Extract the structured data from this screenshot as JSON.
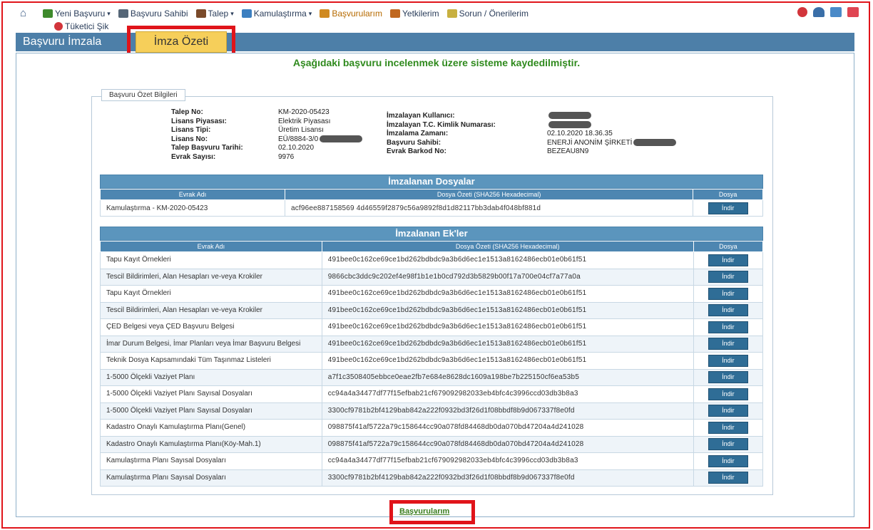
{
  "menu": {
    "row1": [
      {
        "label": "Yeni Başvuru",
        "caret": true,
        "color": "#3e8a2c"
      },
      {
        "label": "Başvuru Sahibi",
        "caret": false,
        "color": "#556677"
      },
      {
        "label": "Talep",
        "caret": true,
        "color": "#7a4a2a"
      },
      {
        "label": "Kamulaştırma",
        "caret": true,
        "color": "#3c7fc0"
      },
      {
        "label": "Başvurularım",
        "caret": false,
        "color": "#d08a20",
        "active": true
      },
      {
        "label": "Yetkilerim",
        "caret": false,
        "color": "#c06820"
      },
      {
        "label": "Sorun / Önerilerim",
        "caret": false,
        "color": "#c8b040"
      }
    ],
    "row2_label": "Tüketici Şik"
  },
  "tabs": {
    "main": "Başvuru İmzala",
    "summary": "İmza Özeti"
  },
  "success_message": "Aşağıdaki başvuru incelenmek üzere sisteme kaydedilmiştir.",
  "summary": {
    "legend": "Başvuru Özet Bilgileri",
    "left": [
      {
        "k": "Talep No:",
        "v": "KM-2020-05423"
      },
      {
        "k": "Lisans Piyasası:",
        "v": "Elektrik Piyasası"
      },
      {
        "k": "Lisans Tipi:",
        "v": "Üretim Lisansı"
      },
      {
        "k": "Lisans No:",
        "v": "EÜ/8884-3/0"
      },
      {
        "k": "Talep Başvuru Tarihi:",
        "v": "02.10.2020"
      },
      {
        "k": "Evrak Sayısı:",
        "v": "9976"
      }
    ],
    "right": [
      {
        "k": "İmzalayan Kullanıcı:",
        "v": ""
      },
      {
        "k": "İmzalayan T.C. Kimlik Numarası:",
        "v": ""
      },
      {
        "k": "İmzalama Zamanı:",
        "v": "02.10.2020 18.36.35"
      },
      {
        "k": "Başvuru Sahibi:",
        "v": "ENERJİ ANONİM ŞİRKETİ"
      },
      {
        "k": "Evrak Barkod No:",
        "v": "BEZEAU8N9"
      }
    ]
  },
  "files_table": {
    "title": "İmzalanan Dosyalar",
    "headers": [
      "Evrak Adı",
      "Dosya Özeti (SHA256 Hexadecimal)",
      "Dosya"
    ],
    "rows": [
      {
        "name": "Kamulaştırma - KM-2020-05423",
        "hash": "acf96ee887158569 4d46559f2879c56a9892f8d1d82117bb3dab4f048bf881d",
        "btn": "İndir"
      }
    ]
  },
  "attachments_table": {
    "title": "İmzalanan Ek'ler",
    "headers": [
      "Evrak Adı",
      "Dosya Özeti (SHA256 Hexadecimal)",
      "Dosya"
    ],
    "rows": [
      {
        "name": "Tapu Kayıt Örnekleri",
        "hash": "491bee0c162ce69ce1bd262bdbdc9a3b6d6ec1e1513a8162486ecb01e0b61f51",
        "btn": "İndir"
      },
      {
        "name": "Tescil Bildirimleri, Alan Hesapları ve-veya Krokiler",
        "hash": "9866cbc3ddc9c202ef4e98f1b1e1b0cd792d3b5829b00f17a700e04cf7a77a0a",
        "btn": "İndir"
      },
      {
        "name": "Tapu Kayıt Örnekleri",
        "hash": "491bee0c162ce69ce1bd262bdbdc9a3b6d6ec1e1513a8162486ecb01e0b61f51",
        "btn": "İndir"
      },
      {
        "name": "Tescil Bildirimleri, Alan Hesapları ve-veya Krokiler",
        "hash": "491bee0c162ce69ce1bd262bdbdc9a3b6d6ec1e1513a8162486ecb01e0b61f51",
        "btn": "İndir"
      },
      {
        "name": "ÇED Belgesi veya ÇED Başvuru Belgesi",
        "hash": "491bee0c162ce69ce1bd262bdbdc9a3b6d6ec1e1513a8162486ecb01e0b61f51",
        "btn": "İndir"
      },
      {
        "name": "İmar Durum Belgesi, İmar Planları veya İmar Başvuru Belgesi",
        "hash": "491bee0c162ce69ce1bd262bdbdc9a3b6d6ec1e1513a8162486ecb01e0b61f51",
        "btn": "İndir"
      },
      {
        "name": "Teknik Dosya Kapsamındaki Tüm Taşınmaz Listeleri",
        "hash": "491bee0c162ce69ce1bd262bdbdc9a3b6d6ec1e1513a8162486ecb01e0b61f51",
        "btn": "İndir"
      },
      {
        "name": "1-5000 Ölçekli Vaziyet Planı",
        "hash": "a7f1c3508405ebbce0eae2fb7e684e8628dc1609a198be7b225150cf6ea53b5",
        "btn": "İndir"
      },
      {
        "name": "1-5000 Ölçekli Vaziyet Planı Sayısal Dosyaları",
        "hash": "cc94a4a34477df77f15efbab21cf679092982033eb4bfc4c3996ccd03db3b8a3",
        "btn": "İndir"
      },
      {
        "name": "1-5000 Ölçekli Vaziyet Planı Sayısal Dosyaları",
        "hash": "3300cf9781b2bf4129bab842a222f0932bd3f26d1f08bbdf8b9d067337f8e0fd",
        "btn": "İndir"
      },
      {
        "name": "Kadastro Onaylı Kamulaştırma Planı(Genel)",
        "hash": "098875f41af5722a79c158644cc90a078fd84468db0da070bd47204a4d241028",
        "btn": "İndir"
      },
      {
        "name": "Kadastro Onaylı Kamulaştırma Planı(Köy-Mah.1)",
        "hash": "098875f41af5722a79c158644cc90a078fd84468db0da070bd47204a4d241028",
        "btn": "İndir"
      },
      {
        "name": "Kamulaştırma Planı Sayısal Dosyaları",
        "hash": "cc94a4a34477df77f15efbab21cf679092982033eb4bfc4c3996ccd03db3b8a3",
        "btn": "İndir"
      },
      {
        "name": "Kamulaştırma Planı Sayısal Dosyaları",
        "hash": "3300cf9781b2bf4129bab842a222f0932bd3f26d1f08bbdf8b9d067337f8e0fd",
        "btn": "İndir"
      }
    ]
  },
  "back_link": "Başvurularım"
}
